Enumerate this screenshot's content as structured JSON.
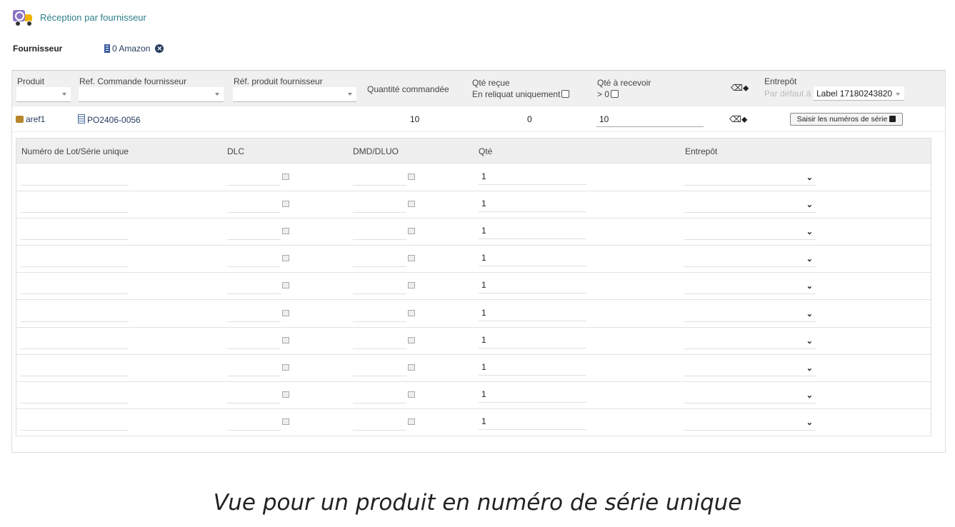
{
  "header": {
    "title": "Réception par fournisseur"
  },
  "supplier": {
    "label": "Fournisseur",
    "value": "0 Amazon"
  },
  "filters": {
    "product": "Produit",
    "supplier_order_ref": "Ref. Commande fournisseur",
    "supplier_product_ref": "Réf. produit fournisseur",
    "qty_ordered": "Quantité commandée",
    "qty_received": "Qté reçue",
    "backorder_only": "En reliquat uniquement",
    "qty_to_receive": "Qté à recevoir",
    "gt_zero": "> 0",
    "warehouse": "Entrepôt",
    "default_at": "Par défaut à",
    "default_warehouse": "Label 17180243820"
  },
  "product_row": {
    "product": "aref1",
    "order_ref": "PO2406-0056",
    "qty_ordered": "10",
    "qty_received": "0",
    "qty_to_receive": "10",
    "serial_button": "Saisir les numéros de série"
  },
  "serial_table": {
    "headers": [
      "Numéro de Lot/Série unique",
      "DLC",
      "DMD/DLUO",
      "Qté",
      "Entrepôt"
    ],
    "rows": [
      {
        "qty": "1"
      },
      {
        "qty": "1"
      },
      {
        "qty": "1"
      },
      {
        "qty": "1"
      },
      {
        "qty": "1"
      },
      {
        "qty": "1"
      },
      {
        "qty": "1"
      },
      {
        "qty": "1"
      },
      {
        "qty": "1"
      },
      {
        "qty": "1"
      }
    ]
  },
  "caption": "Vue pour un produit en numéro de série unique",
  "colors": {
    "title": "#2f7f8a",
    "link": "#263c5c",
    "header_bg": "#f0f0f0"
  }
}
